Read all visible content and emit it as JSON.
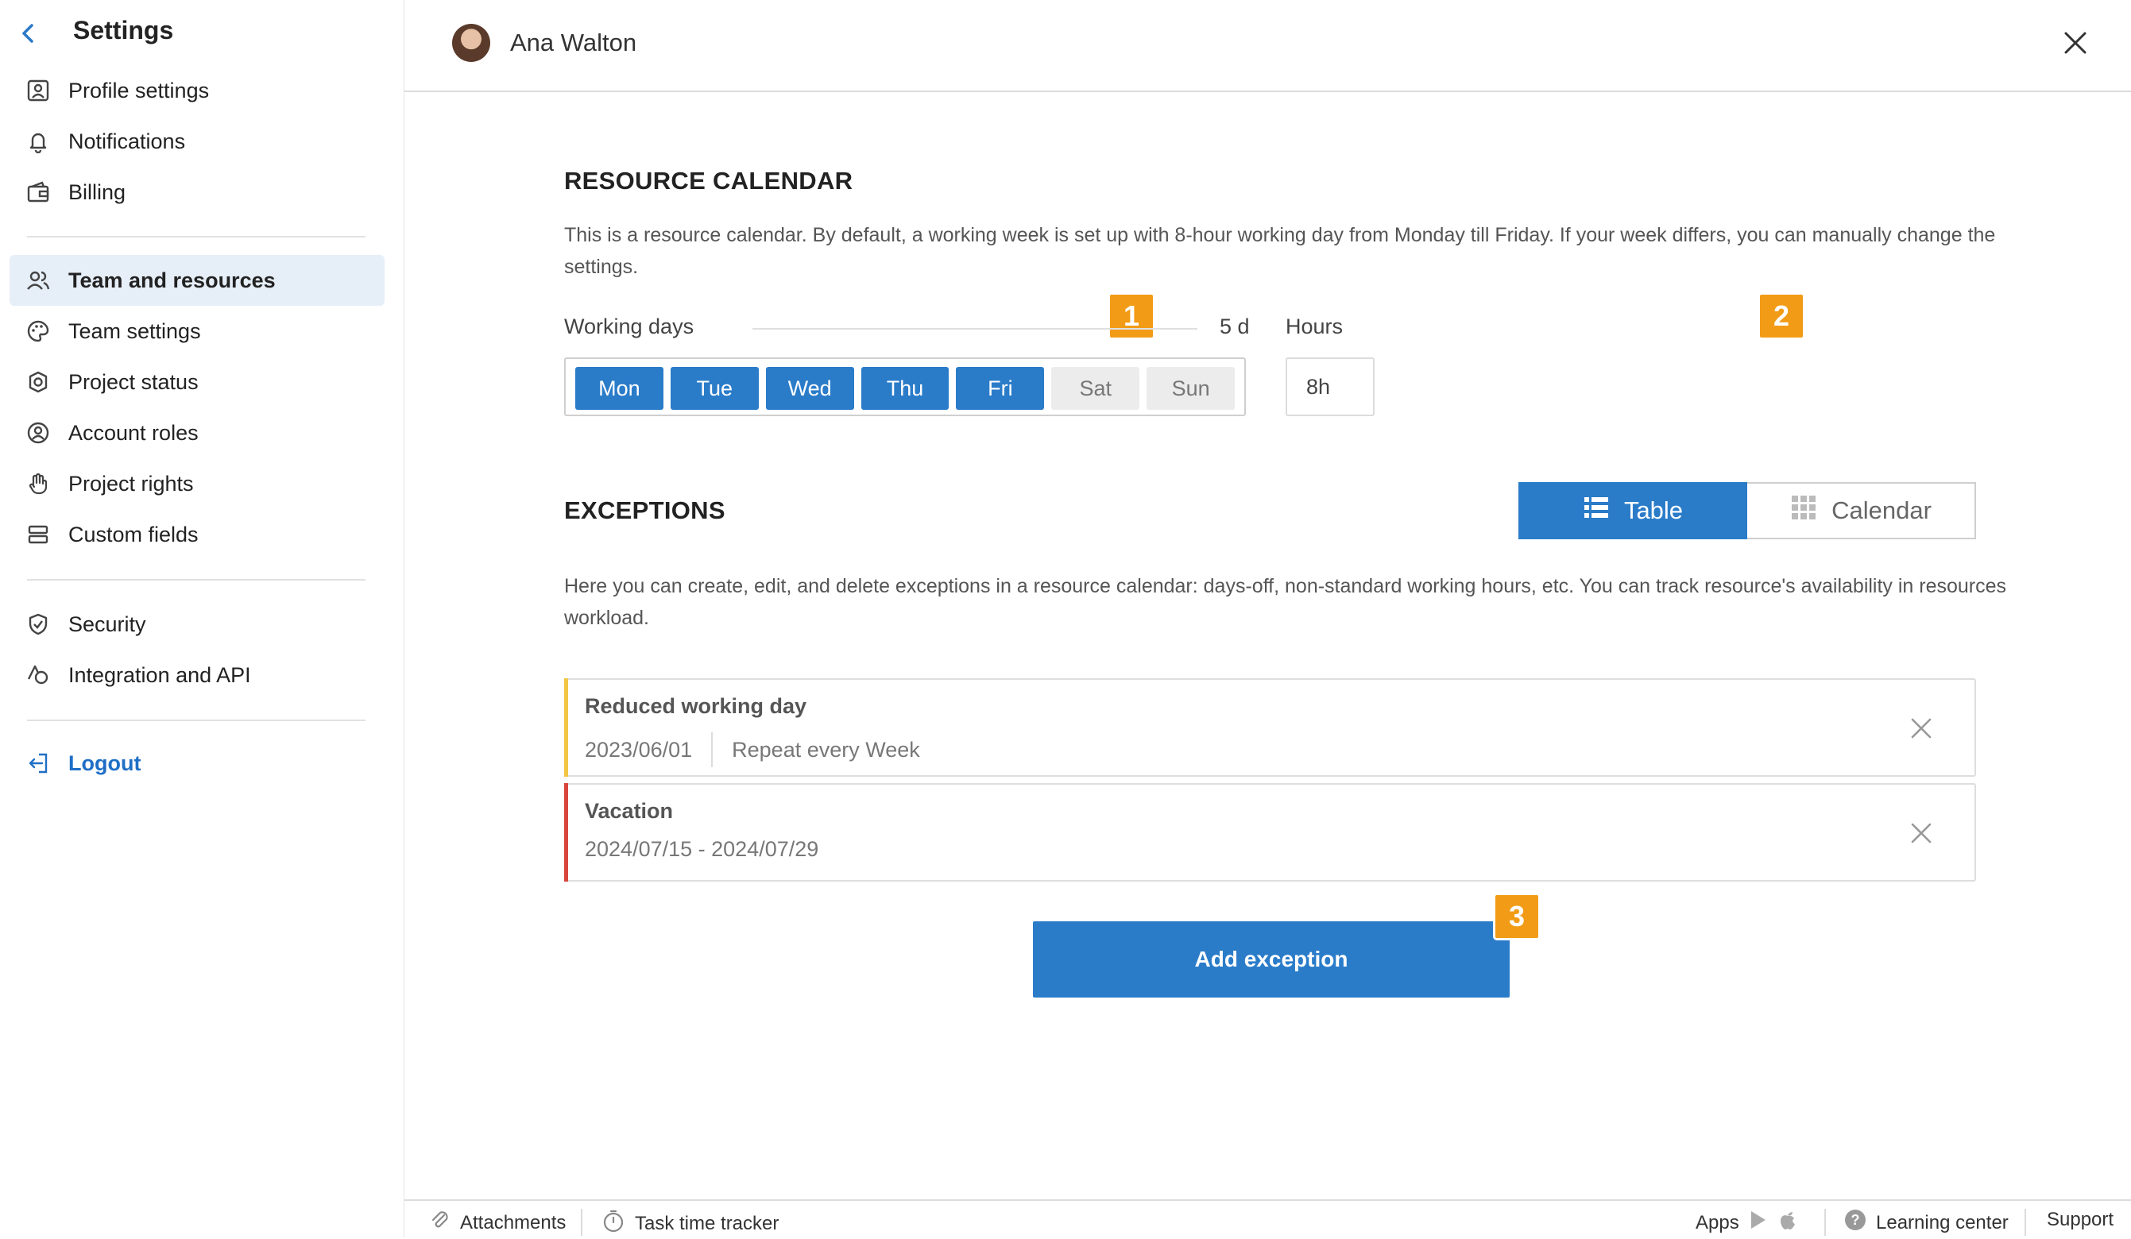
{
  "sidebar": {
    "title": "Settings",
    "group1": [
      {
        "label": "Profile settings",
        "icon": "profile-icon"
      },
      {
        "label": "Notifications",
        "icon": "bell-icon"
      },
      {
        "label": "Billing",
        "icon": "wallet-icon"
      }
    ],
    "group2": [
      {
        "label": "Team and resources",
        "icon": "people-icon",
        "active": true
      },
      {
        "label": "Team settings",
        "icon": "palette-icon"
      },
      {
        "label": "Project status",
        "icon": "status-icon"
      },
      {
        "label": "Account roles",
        "icon": "user-circle-icon"
      },
      {
        "label": "Project rights",
        "icon": "hand-icon"
      },
      {
        "label": "Custom fields",
        "icon": "fields-icon"
      }
    ],
    "group3": [
      {
        "label": "Security",
        "icon": "shield-icon"
      },
      {
        "label": "Integration and API",
        "icon": "integration-icon"
      }
    ],
    "logout": "Logout"
  },
  "header": {
    "user_name": "Ana Walton"
  },
  "resource_calendar": {
    "title": "RESOURCE CALENDAR",
    "description": "This is a resource calendar. By default, a working week is set up with 8-hour working day from Monday till Friday. If your week differs, you can manually change the settings.",
    "working_days_label": "Working days",
    "working_days_value": "5 d",
    "hours_label": "Hours",
    "hours_value": "8h",
    "days": [
      {
        "label": "Mon",
        "on": true
      },
      {
        "label": "Tue",
        "on": true
      },
      {
        "label": "Wed",
        "on": true
      },
      {
        "label": "Thu",
        "on": true
      },
      {
        "label": "Fri",
        "on": true
      },
      {
        "label": "Sat",
        "on": false
      },
      {
        "label": "Sun",
        "on": false
      }
    ]
  },
  "badges": [
    "1",
    "2",
    "3"
  ],
  "exceptions": {
    "title": "EXCEPTIONS",
    "view_table": "Table",
    "view_calendar": "Calendar",
    "description": "Here you can create, edit, and delete exceptions in a resource calendar: days-off, non-standard working hours, etc. You can track resource's availability in resources workload.",
    "items": [
      {
        "title": "Reduced working day",
        "date": "2023/06/01",
        "repeat": "Repeat every Week",
        "color": "#f2c744"
      },
      {
        "title": "Vacation",
        "date": "2024/07/15 - 2024/07/29",
        "color": "#d9453d"
      }
    ],
    "add_button": "Add exception"
  },
  "footer": {
    "attachments": "Attachments",
    "task_time_tracker": "Task time tracker",
    "apps": "Apps",
    "learning_center": "Learning center",
    "support": "Support"
  },
  "colors": {
    "accent": "#2a7cc9",
    "badge": "#f29b16",
    "active_bg": "#e6eef8"
  }
}
